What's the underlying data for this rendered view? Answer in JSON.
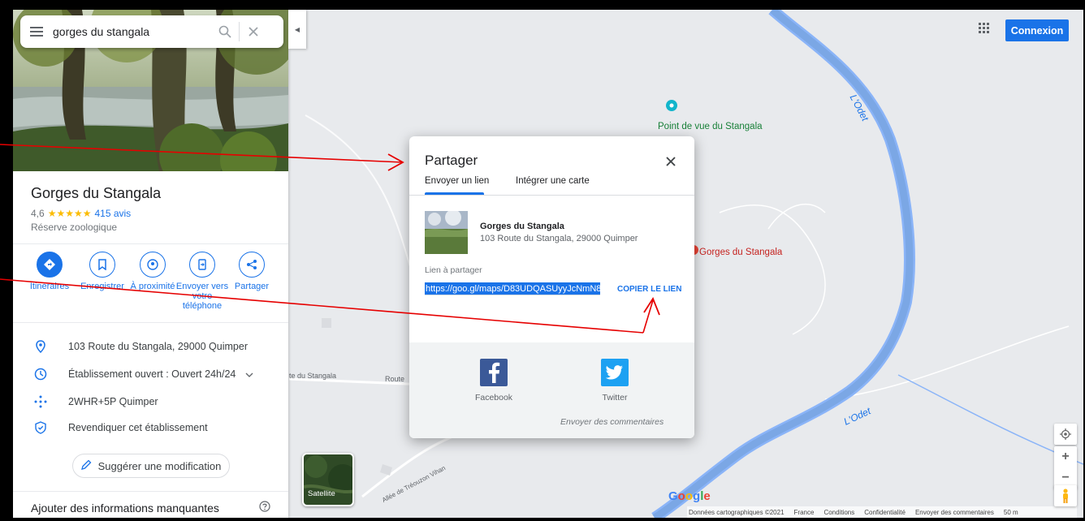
{
  "search": {
    "query": "gorges du stangala"
  },
  "place": {
    "title": "Gorges du Stangala",
    "rating": "4,6",
    "stars": "★★★★★",
    "reviews": "415 avis",
    "category": "Réserve zoologique"
  },
  "actions": [
    {
      "label": "Itinéraires",
      "icon": "directions-icon"
    },
    {
      "label": "Enregistrer",
      "icon": "bookmark-icon"
    },
    {
      "label": "À proximité",
      "icon": "nearby-icon"
    },
    {
      "label": "Envoyer vers votre téléphone",
      "icon": "send-to-phone-icon"
    },
    {
      "label": "Partager",
      "icon": "share-icon"
    }
  ],
  "info": {
    "address": "103 Route du Stangala, 29000 Quimper",
    "hours": "Établissement ouvert : Ouvert 24h/24",
    "pluscode": "2WHR+5P Quimper",
    "claim": "Revendiquer cet établissement"
  },
  "suggest_label": "Suggérer une modification",
  "missing_info": "Ajouter des informations manquantes",
  "header": {
    "connexion": "Connexion"
  },
  "map": {
    "poi_viewpoint": "Point de vue du Stangala",
    "poi_place": "Gorges du Stangala",
    "river_1": "L'Odet",
    "river_2": "L'Odet",
    "road_1": "te du Stangala",
    "road_2": "Route",
    "road_3": "Allée de Tréouzon Vihan",
    "satellite": "Satellite",
    "google": "Google",
    "footer": [
      "Données cartographiques ©2021",
      "France",
      "Conditions",
      "Confidentialité",
      "Envoyer des commentaires",
      "50 m"
    ]
  },
  "share_dialog": {
    "title": "Partager",
    "tab_send": "Envoyer un lien",
    "tab_embed": "Intégrer une carte",
    "place_name": "Gorges du Stangala",
    "place_address": "103 Route du Stangala, 29000 Quimper",
    "link_label": "Lien à partager",
    "link_value": "https://goo.gl/maps/D83UDQASUyyJcNmN8",
    "copy_label": "COPIER LE LIEN",
    "facebook": "Facebook",
    "twitter": "Twitter",
    "feedback": "Envoyer des commentaires"
  },
  "colors": {
    "accent": "#1a73e8",
    "river": "#7ba7e5",
    "annotation": "#e60000"
  }
}
